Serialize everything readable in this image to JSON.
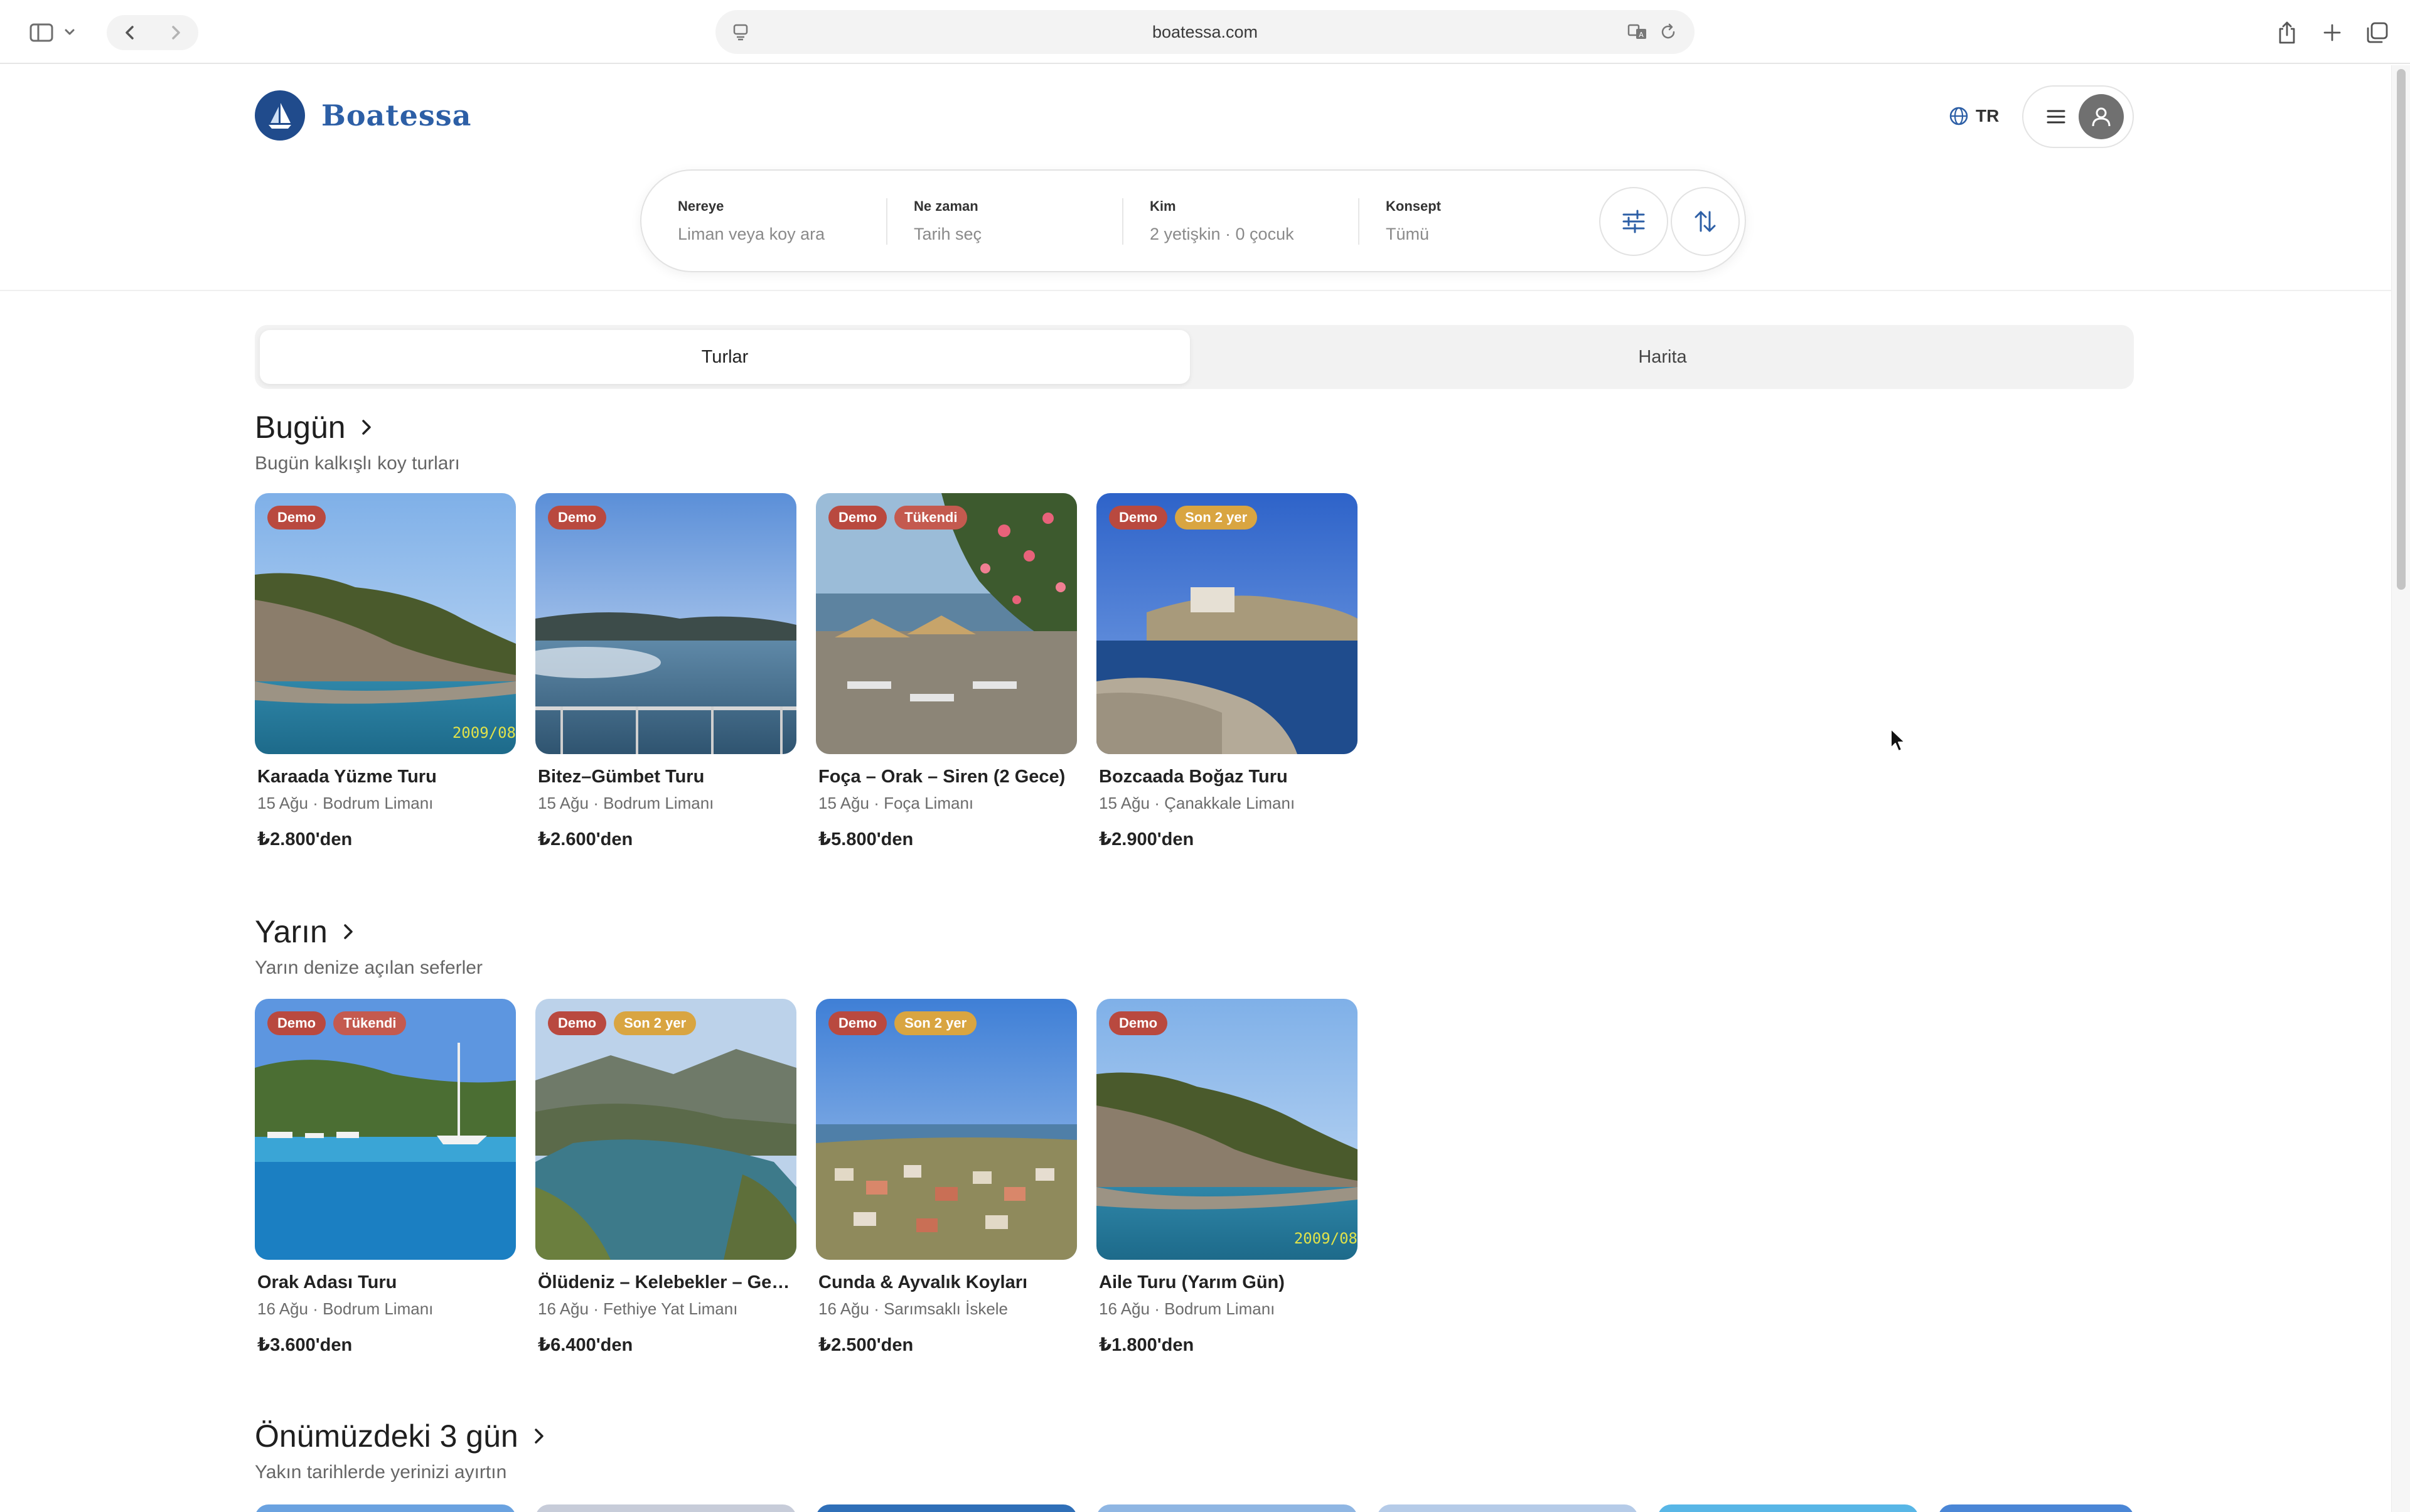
{
  "browser": {
    "url": "boatessa.com"
  },
  "site": {
    "brand": "Boatessa",
    "lang": "TR"
  },
  "search": {
    "where": {
      "label": "Nereye",
      "value": "Liman veya koy ara"
    },
    "when": {
      "label": "Ne zaman",
      "value": "Tarih seç"
    },
    "who": {
      "label": "Kim",
      "value": "2 yetişkin · 0 çocuk"
    },
    "concept": {
      "label": "Konsept",
      "value": "Tümü"
    }
  },
  "tabs": {
    "tours": "Turlar",
    "map": "Harita"
  },
  "sections": [
    {
      "title": "Bugün",
      "subtitle": "Bugün kalkışlı koy turları",
      "cards": [
        {
          "name": "Karaada Yüzme Turu",
          "meta": "15 Ağu · Bodrum Limanı",
          "price": "₺2.800'den",
          "badges": [
            "Demo"
          ],
          "stamp": "2009/08"
        },
        {
          "name": "Bitez–Gümbet Turu",
          "meta": "15 Ağu · Bodrum Limanı",
          "price": "₺2.600'den",
          "badges": [
            "Demo"
          ]
        },
        {
          "name": "Foça – Orak – Siren (2 Gece)",
          "meta": "15 Ağu · Foça Limanı",
          "price": "₺5.800'den",
          "badges": [
            "Demo",
            "Tükendi"
          ]
        },
        {
          "name": "Bozcaada Boğaz Turu",
          "meta": "15 Ağu · Çanakkale Limanı",
          "price": "₺2.900'den",
          "badges": [
            "Demo",
            "Son 2 yer"
          ]
        }
      ]
    },
    {
      "title": "Yarın",
      "subtitle": "Yarın denize açılan seferler",
      "cards": [
        {
          "name": "Orak Adası Turu",
          "meta": "16 Ağu · Bodrum Limanı",
          "price": "₺3.600'den",
          "badges": [
            "Demo",
            "Tükendi"
          ]
        },
        {
          "name": "Ölüdeniz – Kelebekler – Gemiler",
          "meta": "16 Ağu · Fethiye Yat Limanı",
          "price": "₺6.400'den",
          "badges": [
            "Demo",
            "Son 2 yer"
          ]
        },
        {
          "name": "Cunda & Ayvalık Koyları",
          "meta": "16 Ağu · Sarımsaklı İskele",
          "price": "₺2.500'den",
          "badges": [
            "Demo",
            "Son 2 yer"
          ]
        },
        {
          "name": "Aile Turu (Yarım Gün)",
          "meta": "16 Ağu · Bodrum Limanı",
          "price": "₺1.800'den",
          "badges": [
            "Demo"
          ],
          "stamp": "2009/08"
        }
      ]
    },
    {
      "title": "Önümüzdeki 3 gün",
      "subtitle": "Yakın tarihlerde yerinizi ayırtın"
    }
  ],
  "colors": {
    "brand": "#2d5fa6",
    "badge_demo": "#b9493f",
    "badge_soldout": "#c45a4f",
    "badge_last": "#d9a541"
  }
}
